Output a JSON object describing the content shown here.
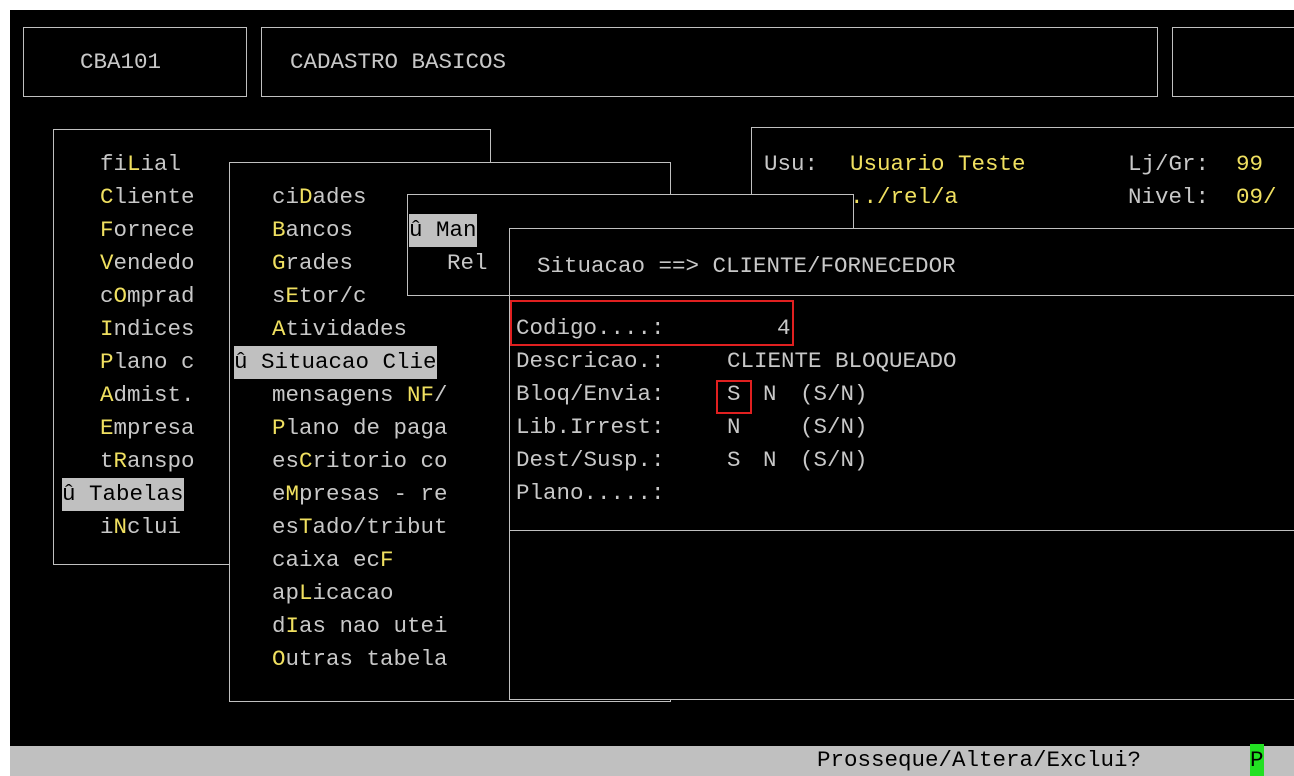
{
  "header": {
    "program_code": "CBA101",
    "program_title": "CADASTRO BASICOS"
  },
  "main_menu": {
    "items": [
      {
        "pre": "fi",
        "hot": "L",
        "post": "ial"
      },
      {
        "pre": "",
        "hot": "C",
        "post": "liente"
      },
      {
        "pre": "",
        "hot": "F",
        "post": "ornece"
      },
      {
        "pre": "",
        "hot": "V",
        "post": "endedo"
      },
      {
        "pre": "c",
        "hot": "O",
        "post": "mprad"
      },
      {
        "pre": "",
        "hot": "I",
        "post": "ndices"
      },
      {
        "pre": "",
        "hot": "P",
        "post": "lano c"
      },
      {
        "pre": "",
        "hot": "A",
        "post": "dmist."
      },
      {
        "pre": "",
        "hot": "E",
        "post": "mpresa"
      },
      {
        "pre": "t",
        "hot": "R",
        "post": "anspo"
      },
      {
        "pre": "",
        "hot": "",
        "post": "û Tabelas"
      },
      {
        "pre": "i",
        "hot": "N",
        "post": "clui"
      }
    ]
  },
  "tables_menu": {
    "items": [
      {
        "pre": "ci",
        "hot": "D",
        "post": "ades"
      },
      {
        "pre": "",
        "hot": "B",
        "post": "ancos"
      },
      {
        "pre": "",
        "hot": "G",
        "post": "rades"
      },
      {
        "pre": "s",
        "hot": "E",
        "post": "tor/c"
      },
      {
        "pre": "",
        "hot": "A",
        "post": "tividades"
      },
      {
        "pre": "",
        "hot": "",
        "post": "û Situacao Clie"
      },
      {
        "pre": "mensagens ",
        "hot": "NF",
        "post": "/"
      },
      {
        "pre": "",
        "hot": "P",
        "post": "lano de paga"
      },
      {
        "pre": "es",
        "hot": "C",
        "post": "ritorio co"
      },
      {
        "pre": "e",
        "hot": "M",
        "post": "presas - re"
      },
      {
        "pre": "es",
        "hot": "T",
        "post": "ado/tribut"
      },
      {
        "pre": "caixa ec",
        "hot": "F",
        "post": ""
      },
      {
        "pre": "ap",
        "hot": "L",
        "post": "icacao"
      },
      {
        "pre": "d",
        "hot": "I",
        "post": "as nao utei"
      },
      {
        "pre": "",
        "hot": "O",
        "post": "utras tabela"
      }
    ]
  },
  "sub_menu": {
    "manut": "û Man",
    "rel": "Rel"
  },
  "user_info": {
    "usu_label": "Usu:",
    "usu_value": "Usuario Teste",
    "path": "../rel/a",
    "loja_label": "Lj/Gr:",
    "loja_value": "99",
    "nivel_label": "Nivel:",
    "nivel_value": "09/"
  },
  "form": {
    "title": "Situacao ==> CLIENTE/FORNECEDOR",
    "codigo_label": "Codigo....:",
    "codigo_value": "4",
    "descricao_label": "Descricao.:",
    "descricao_value": "CLIENTE BLOQUEADO",
    "bloq_label": "Bloq/Envia:",
    "bloq_value1": "S",
    "bloq_value2": "N",
    "bloq_hint": "(S/N)",
    "lib_label": "Lib.Irrest:",
    "lib_value": "N",
    "lib_hint": "(S/N)",
    "dest_label": "Dest/Susp.:",
    "dest_value1": "S",
    "dest_value2": "N",
    "dest_hint": "(S/N)",
    "plano_label": "Plano.....:"
  },
  "status": {
    "prompt": "Prosseque/Altera/Exclui?",
    "cursor_value": "P"
  },
  "colors": {
    "background": "#000000",
    "text": "#c8c8c8",
    "hotkey": "#f0e060",
    "highlight": "#c0c0c0",
    "focus_box": "#e02020",
    "cursor": "#22e022"
  }
}
